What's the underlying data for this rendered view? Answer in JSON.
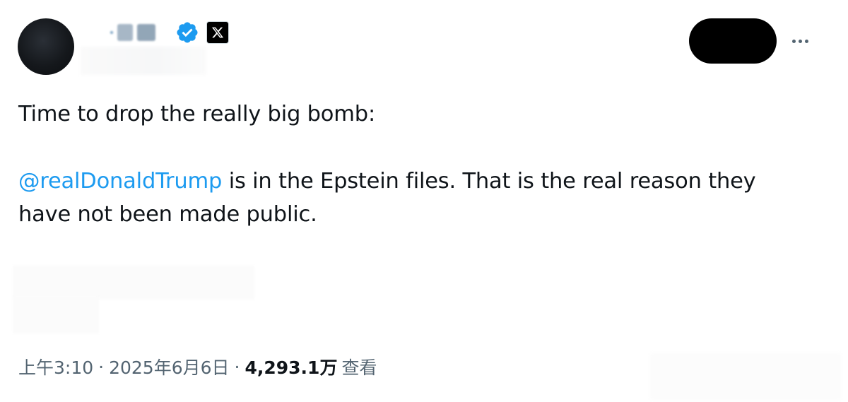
{
  "tweet": {
    "author": {
      "name_chars": [
        "·",
        "₤",
        "ᴥ"
      ],
      "badge_names": [
        "verified-badge-icon",
        "x-logo-icon"
      ],
      "accent_color": "#1d9bf0"
    },
    "more_icon": "more-horizontal-icon",
    "text": {
      "line1": "Time to drop the really big bomb:",
      "mention": "@realDonaldTrump",
      "line2_rest": " is in the Epstein files. That is the real reason they",
      "line3": "have not been made public."
    },
    "meta": {
      "time": "上午3:10",
      "separator": "·",
      "date": "2025年6月6日",
      "views_count": "4,293.1万",
      "views_label": "查看"
    }
  }
}
